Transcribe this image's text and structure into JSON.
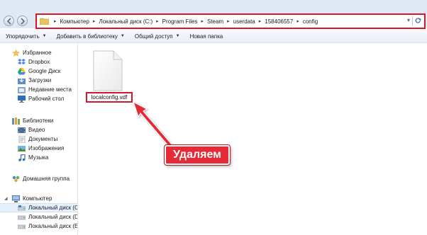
{
  "address_bar": {
    "breadcrumbs": [
      "Компьютер",
      "Локальный диск (C:)",
      "Program Files",
      "Steam",
      "userdata",
      "158406557",
      "config"
    ],
    "separator": "▸",
    "dropdown_glyph": "▾"
  },
  "toolbar": {
    "items": [
      {
        "label": "Упорядочить",
        "has_dropdown": true
      },
      {
        "label": "Добавить в библиотеку",
        "has_dropdown": true
      },
      {
        "label": "Общий доступ",
        "has_dropdown": true
      },
      {
        "label": "Новая папка",
        "has_dropdown": false
      }
    ],
    "dropdown_glyph": "▼"
  },
  "sidebar": {
    "favorites": {
      "label": "Избранное",
      "icon": "star-icon",
      "items": [
        {
          "label": "Dropbox",
          "icon": "dropbox-icon"
        },
        {
          "label": "Google Диск",
          "icon": "google-drive-icon"
        },
        {
          "label": "Загрузки",
          "icon": "downloads-icon"
        },
        {
          "label": "Недавние места",
          "icon": "recent-places-icon"
        },
        {
          "label": "Рабочий стол",
          "icon": "desktop-icon"
        }
      ]
    },
    "libraries": {
      "label": "Библиотеки",
      "icon": "libraries-icon",
      "items": [
        {
          "label": "Видео",
          "icon": "video-icon"
        },
        {
          "label": "Документы",
          "icon": "documents-icon"
        },
        {
          "label": "Изображения",
          "icon": "pictures-icon"
        },
        {
          "label": "Музыка",
          "icon": "music-icon"
        }
      ]
    },
    "homegroup": {
      "label": "Домашняя группа",
      "icon": "homegroup-icon"
    },
    "computer": {
      "label": "Компьютер",
      "icon": "computer-icon",
      "items": [
        {
          "label": "Локальный диск (C",
          "icon": "drive-icon",
          "selected": true
        },
        {
          "label": "Локальный диск (D",
          "icon": "drive-icon",
          "selected": false
        },
        {
          "label": "Локальный диск (E",
          "icon": "drive-icon",
          "selected": false
        }
      ]
    },
    "expander_glyph": "◢"
  },
  "content": {
    "file": {
      "name": "localconfig.vdf",
      "icon": "file-icon"
    },
    "callout_text": "Удаляем"
  },
  "colors": {
    "highlight_red": "#d3182c",
    "callout_red": "#e62a36",
    "selection_blue": "#e5f0fb"
  }
}
